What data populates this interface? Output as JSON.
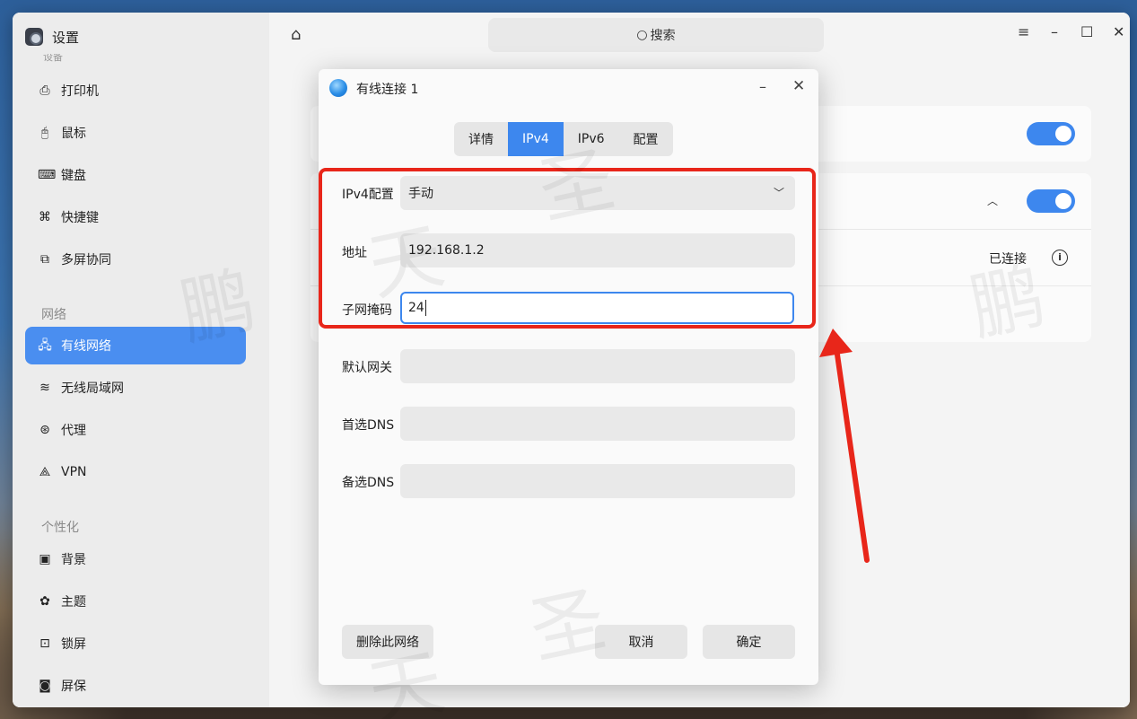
{
  "app": {
    "title": "设置",
    "cut_section_label": "设备"
  },
  "sidebar": {
    "items_top": [
      {
        "label": "打印机",
        "icon": "printer-icon",
        "glyph": "⎙"
      },
      {
        "label": "鼠标",
        "icon": "mouse-icon",
        "glyph": "🖰"
      },
      {
        "label": "键盘",
        "icon": "keyboard-icon",
        "glyph": "⌨"
      },
      {
        "label": "快捷键",
        "icon": "shortcut-icon",
        "glyph": "⌘"
      },
      {
        "label": "多屏协同",
        "icon": "multiscreen-icon",
        "glyph": "⧉"
      }
    ],
    "section_network": "网络",
    "items_network": [
      {
        "label": "有线网络",
        "icon": "wired-network-icon",
        "glyph": "🖧",
        "active": true
      },
      {
        "label": "无线局域网",
        "icon": "wifi-icon",
        "glyph": "≋"
      },
      {
        "label": "代理",
        "icon": "proxy-icon",
        "glyph": "⊛"
      },
      {
        "label": "VPN",
        "icon": "vpn-icon",
        "glyph": "⟁"
      }
    ],
    "section_personal": "个性化",
    "items_personal": [
      {
        "label": "背景",
        "icon": "wallpaper-icon",
        "glyph": "▣"
      },
      {
        "label": "主题",
        "icon": "theme-icon",
        "glyph": "✿"
      },
      {
        "label": "锁屏",
        "icon": "lockscreen-icon",
        "glyph": "⊡"
      },
      {
        "label": "屏保",
        "icon": "screensaver-icon",
        "glyph": "◙"
      }
    ]
  },
  "header": {
    "search_placeholder": "搜索",
    "menu_glyph": "≡",
    "minimize_glyph": "–",
    "maximize_glyph": "☐",
    "close_glyph": "✕"
  },
  "main": {
    "connection_status": "已连接",
    "info_glyph": "i"
  },
  "dialog": {
    "title": "有线连接 1",
    "tabs": [
      {
        "label": "详情"
      },
      {
        "label": "IPv4",
        "active": true
      },
      {
        "label": "IPv6"
      },
      {
        "label": "配置"
      }
    ],
    "fields": {
      "ipv4_config_label": "IPv4配置",
      "ipv4_config_value": "手动",
      "address_label": "地址",
      "address_value": "192.168.1.2",
      "subnet_label": "子网掩码",
      "subnet_value": "24",
      "gateway_label": "默认网关",
      "gateway_value": "",
      "dns1_label": "首选DNS",
      "dns1_value": "",
      "dns2_label": "备选DNS",
      "dns2_value": ""
    },
    "buttons": {
      "delete": "删除此网络",
      "cancel": "取消",
      "confirm": "确定"
    }
  },
  "watermark": {
    "char1": "鹏",
    "char2": "天",
    "char3": "圣"
  },
  "colors": {
    "accent": "#3d87ee",
    "highlight": "#e8261a",
    "sidebar_active": "#4a8ef0"
  }
}
